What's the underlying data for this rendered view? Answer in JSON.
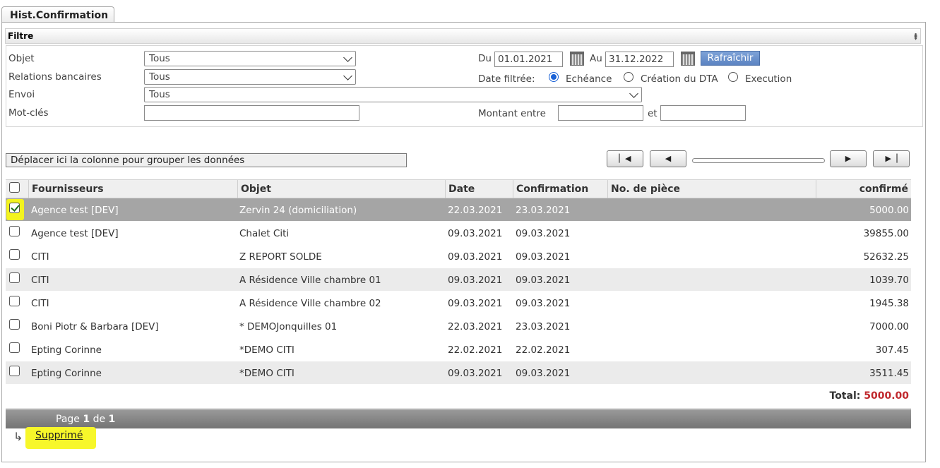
{
  "tab": {
    "label": "Hist.Confirmation"
  },
  "filter": {
    "header": "Filtre",
    "objet_label": "Objet",
    "objet_value": "Tous",
    "relations_label": "Relations bancaires",
    "relations_value": "Tous",
    "envoi_label": "Envoi",
    "envoi_value": "Tous",
    "motcles_label": "Mot-clés",
    "motcles_value": "",
    "du_label": "Du",
    "du_value": "01.01.2021",
    "au_label": "Au",
    "au_value": "31.12.2022",
    "refresh_label": "Rafraîchir",
    "date_filter_label": "Date filtrée:",
    "radio_echeance": "Echéance",
    "radio_creation": "Création du DTA",
    "radio_execution": "Execution",
    "montant_label": "Montant entre",
    "montant_from": "",
    "et_label": "et",
    "montant_to": ""
  },
  "grid": {
    "group_hint": "Déplacer ici la colonne pour grouper les données",
    "columns": {
      "fournisseurs": "Fournisseurs",
      "objet": "Objet",
      "date": "Date",
      "confirmation": "Confirmation",
      "piece": "No. de pièce",
      "confirme": "confirmé"
    },
    "rows": [
      {
        "fournisseur": "Agence test [DEV]",
        "objet": "Zervin 24 (domiciliation)",
        "date": "22.03.2021",
        "confirmation": "23.03.2021",
        "piece": "",
        "confirme": "5000.00"
      },
      {
        "fournisseur": "Agence test [DEV]",
        "objet": "Chalet Citi",
        "date": "09.03.2021",
        "confirmation": "09.03.2021",
        "piece": "",
        "confirme": "39855.00"
      },
      {
        "fournisseur": "CITI",
        "objet": "Z REPORT SOLDE",
        "date": "09.03.2021",
        "confirmation": "09.03.2021",
        "piece": "",
        "confirme": "52632.25"
      },
      {
        "fournisseur": "CITI",
        "objet": "A Résidence Ville chambre 01",
        "date": "09.03.2021",
        "confirmation": "09.03.2021",
        "piece": "",
        "confirme": "1039.70"
      },
      {
        "fournisseur": "CITI",
        "objet": "A Résidence Ville chambre 02",
        "date": "09.03.2021",
        "confirmation": "09.03.2021",
        "piece": "",
        "confirme": "1945.38"
      },
      {
        "fournisseur": "Boni Piotr & Barbara [DEV]",
        "objet": "* DEMOJonquilles 01",
        "date": "22.03.2021",
        "confirmation": "23.03.2021",
        "piece": "",
        "confirme": "7000.00"
      },
      {
        "fournisseur": "Epting Corinne",
        "objet": "*DEMO CITI",
        "date": "22.02.2021",
        "confirmation": "22.02.2021",
        "piece": "",
        "confirme": "307.45"
      },
      {
        "fournisseur": "Epting Corinne",
        "objet": "*DEMO CITI",
        "date": "09.03.2021",
        "confirmation": "09.03.2021",
        "piece": "",
        "confirme": "3511.45"
      }
    ],
    "total_label": "Total:",
    "total_value": "5000.00",
    "page_word": "Page",
    "page_current": "1",
    "page_of": "de",
    "page_total": "1"
  },
  "actions": {
    "deleted_link": "Supprimé"
  },
  "colors": {
    "total_red": "#c0282d",
    "highlight": "#f3f31e",
    "selected_row": "#a5a5a5"
  }
}
